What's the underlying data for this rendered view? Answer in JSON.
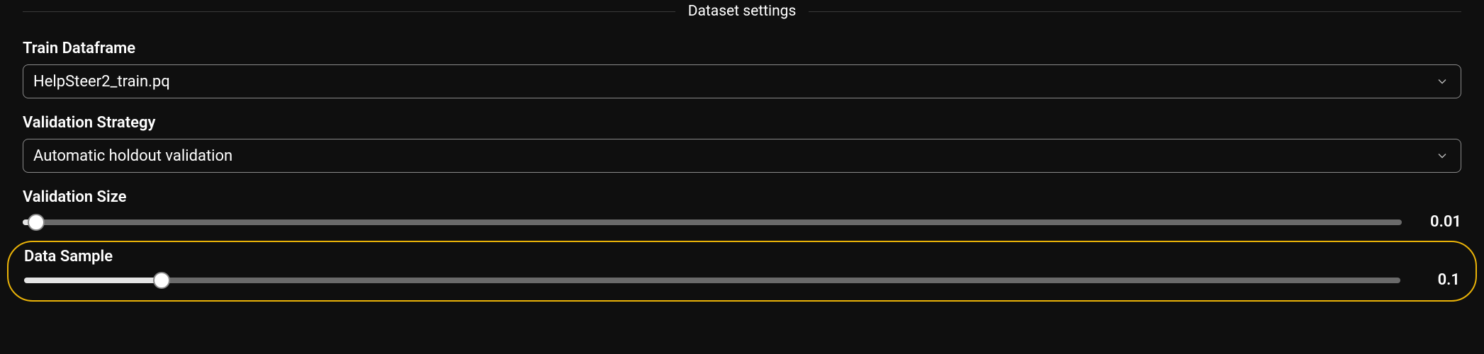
{
  "section": {
    "title": "Dataset settings"
  },
  "fields": {
    "train_dataframe": {
      "label": "Train Dataframe",
      "value": "HelpSteer2_train.pq"
    },
    "validation_strategy": {
      "label": "Validation Strategy",
      "value": "Automatic holdout validation"
    },
    "validation_size": {
      "label": "Validation Size",
      "value_display": "0.01",
      "fill_percent": 1,
      "thumb_percent": 1
    },
    "data_sample": {
      "label": "Data Sample",
      "value_display": "0.1",
      "fill_percent": 10,
      "thumb_percent": 10
    }
  }
}
